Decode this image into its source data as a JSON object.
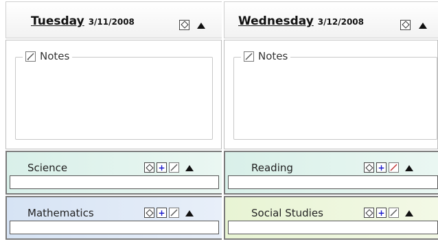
{
  "days": [
    {
      "name": "Tuesday",
      "date": "3/11/2008",
      "notes_label": "Notes",
      "subjects": [
        {
          "label": "Science",
          "color": "#dff3ee"
        },
        {
          "label": "Mathematics",
          "color": "#dce7f5"
        }
      ]
    },
    {
      "name": "Wednesday",
      "date": "3/12/2008",
      "notes_label": "Notes",
      "subjects": [
        {
          "label": "Reading",
          "color": "#dff3ee"
        },
        {
          "label": "Social Studies",
          "color": "#eef6da"
        }
      ]
    }
  ]
}
